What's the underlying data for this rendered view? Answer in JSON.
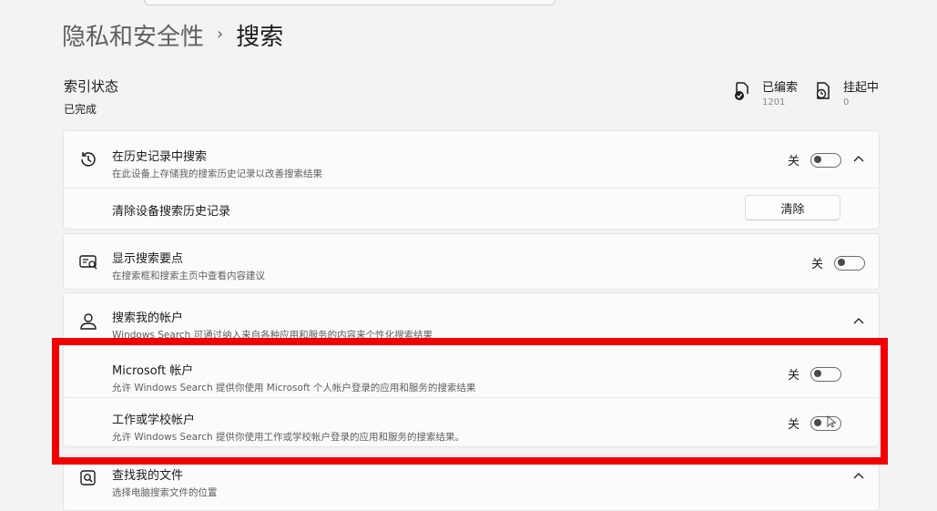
{
  "breadcrumb": {
    "parent": "隐私和安全性",
    "separator": "›",
    "current": "搜索"
  },
  "index_status": {
    "title": "索引状态",
    "value": "已完成"
  },
  "stats": {
    "indexed": {
      "label": "已编索",
      "count": "1201"
    },
    "pending": {
      "label": "挂起中",
      "count": "0"
    }
  },
  "history": {
    "title": "在历史记录中搜索",
    "description": "在此设备上存储我的搜索历史记录以改善搜索结果",
    "toggle_label": "关",
    "clear_row_label": "清除设备搜索历史记录",
    "clear_button": "清除"
  },
  "highlights": {
    "title": "显示搜索要点",
    "description": "在搜索框和搜索主页中查看内容建议",
    "toggle_label": "关"
  },
  "accounts": {
    "title": "搜索我的帐户",
    "description": "Windows Search 可通过纳入来自各种应用和服务的内容来个性化搜索结果",
    "microsoft": {
      "title": "Microsoft 帐户",
      "description": "允许 Windows Search 提供你使用 Microsoft 个人帐户登录的应用和服务的搜索结果",
      "toggle_label": "关"
    },
    "work": {
      "title": "工作或学校帐户",
      "description": "允许 Windows Search 提供你使用工作或学校帐户登录的应用和服务的搜索结果。",
      "toggle_label": "关"
    }
  },
  "find_files": {
    "title": "查找我的文件",
    "description": "选择电脑搜索文件的位置"
  },
  "colors": {
    "highlight_border": "#f00000",
    "background": "#f3f3f3",
    "card": "#fbfbfb"
  },
  "icons": [
    "history-icon",
    "search-highlights-icon",
    "person-icon",
    "search-file-icon",
    "indexed-doc-icon",
    "pending-doc-icon",
    "chevron-up-icon"
  ]
}
